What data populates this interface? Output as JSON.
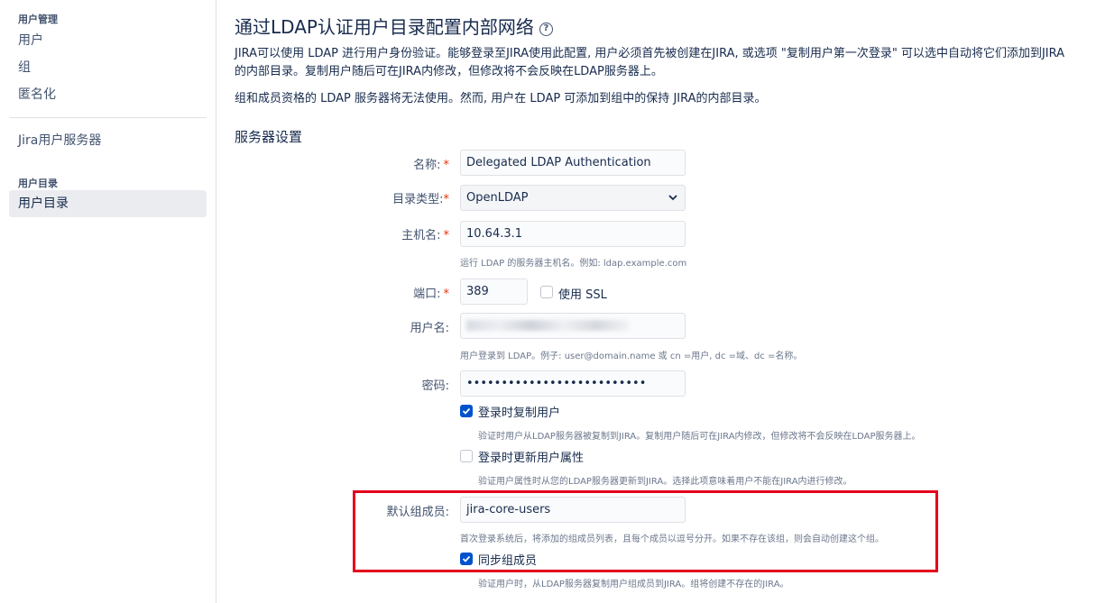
{
  "sidebar": {
    "section1_heading": "用户管理",
    "items1": [
      {
        "label": "用户"
      },
      {
        "label": "组"
      },
      {
        "label": "匿名化"
      }
    ],
    "jira_server": "Jira用户服务器",
    "section2_heading": "用户目录",
    "active_item": "用户目录"
  },
  "page": {
    "title": "通过LDAP认证用户目录配置内部网络",
    "help_icon_glyph": "?",
    "desc1": "JIRA可以使用 LDAP 进行用户身份验证。能够登录至JIRA使用此配置, 用户必须首先被创建在JIRA, 或选项 \"复制用户第一次登录\" 可以选中自动将它们添加到JIRA的内部目录。复制用户随后可在JIRA内修改，但修改将不会反映在LDAP服务器上。",
    "desc2": "组和成员资格的 LDAP 服务器将无法使用。然而, 用户在 LDAP 可添加到组中的保持 JIRA的内部目录。",
    "section_title": "服务器设置"
  },
  "form": {
    "name_label": "名称:",
    "name_value": "Delegated LDAP Authentication",
    "dirtype_label": "目录类型:",
    "dirtype_value": "OpenLDAP",
    "host_label": "主机名:",
    "host_value": "10.64.3.1",
    "host_hint": "运行 LDAP 的服务器主机名。例如: ldap.example.com",
    "port_label": "端口:",
    "port_value": "389",
    "ssl_label": "使用 SSL",
    "ssl_checked": false,
    "username_label": "用户名:",
    "username_hint": "用户登录到 LDAP。例子: user@domain.name 或 cn =用户, dc =域、dc =名称。",
    "password_label": "密码:",
    "password_value": "••••••••••••••••••••••••••",
    "copy_user_label": "登录时复制用户",
    "copy_user_checked": true,
    "copy_user_hint": "验证时用户从LDAP服务器被复制到JIRA。复制用户随后可在JIRA内修改，但修改将不会反映在LDAP服务器上。",
    "update_attr_label": "登录时更新用户属性",
    "update_attr_checked": false,
    "update_attr_hint": "验证用户属性时从您的LDAP服务器更新到JIRA。选择此项意味着用户不能在JIRA内进行修改。",
    "default_group_label": "默认组成员:",
    "default_group_value": "jira-core-users",
    "default_group_hint": "首次登录系统后，将添加的组成员列表，且每个成员以逗号分开。如果不存在该组，则会自动创建这个组。",
    "sync_group_label": "同步组成员",
    "sync_group_checked": true,
    "sync_group_hint": "验证用户时，从LDAP服务器复制用户组成员到JIRA。组将创建不存在的JIRA。",
    "required_mark": "*"
  },
  "colors": {
    "accent": "#0052cc",
    "required": "#de350b",
    "highlight_border": "#e3001b",
    "sidebar_active_bg": "#ebecf0"
  }
}
